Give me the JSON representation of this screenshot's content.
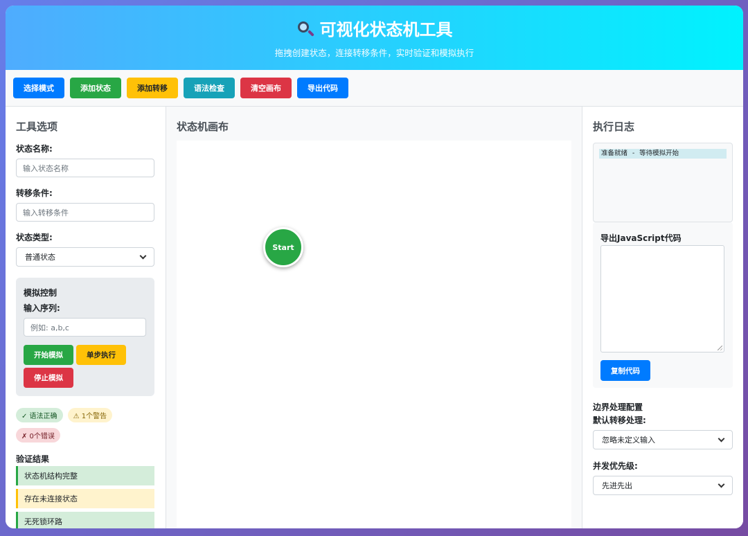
{
  "header": {
    "icon": "magnifier-icon",
    "title": "可视化状态机工具",
    "subtitle": "拖拽创建状态，连接转移条件，实时验证和模拟执行"
  },
  "toolbar": {
    "select_mode": "选择模式",
    "add_state": "添加状态",
    "add_transition": "添加转移",
    "syntax_check": "语法检查",
    "clear_canvas": "清空画布",
    "export_code": "导出代码"
  },
  "left": {
    "title": "工具选项",
    "state_name_label": "状态名称:",
    "state_name_placeholder": "输入状态名称",
    "transition_label": "转移条件:",
    "transition_placeholder": "输入转移条件",
    "state_type_label": "状态类型:",
    "state_type_value": "普通状态",
    "simulation": {
      "title": "模拟控制",
      "input_label": "输入序列:",
      "input_placeholder": "例如: a,b,c",
      "start": "开始模拟",
      "step": "单步执行",
      "stop": "停止模拟"
    },
    "badges": {
      "ok": "✓ 语法正确",
      "warn": "⚠ 1个警告",
      "err": "✗ 0个错误"
    },
    "validation": {
      "title": "验证结果",
      "items": [
        "状态机结构完整",
        "存在未连接状态",
        "无死锁环路"
      ]
    }
  },
  "center": {
    "title": "状态机画布",
    "start_state": "Start"
  },
  "right": {
    "title": "执行日志",
    "log_lines": [
      "准备就绪 - 等待模拟开始"
    ],
    "export_title": "导出JavaScript代码",
    "copy_button": "复制代码",
    "edge_title": "边界处理配置",
    "default_transition_label": "默认转移处理:",
    "default_transition_value": "忽略未定义输入",
    "priority_label": "并发优先级:",
    "priority_value": "先进先出"
  }
}
